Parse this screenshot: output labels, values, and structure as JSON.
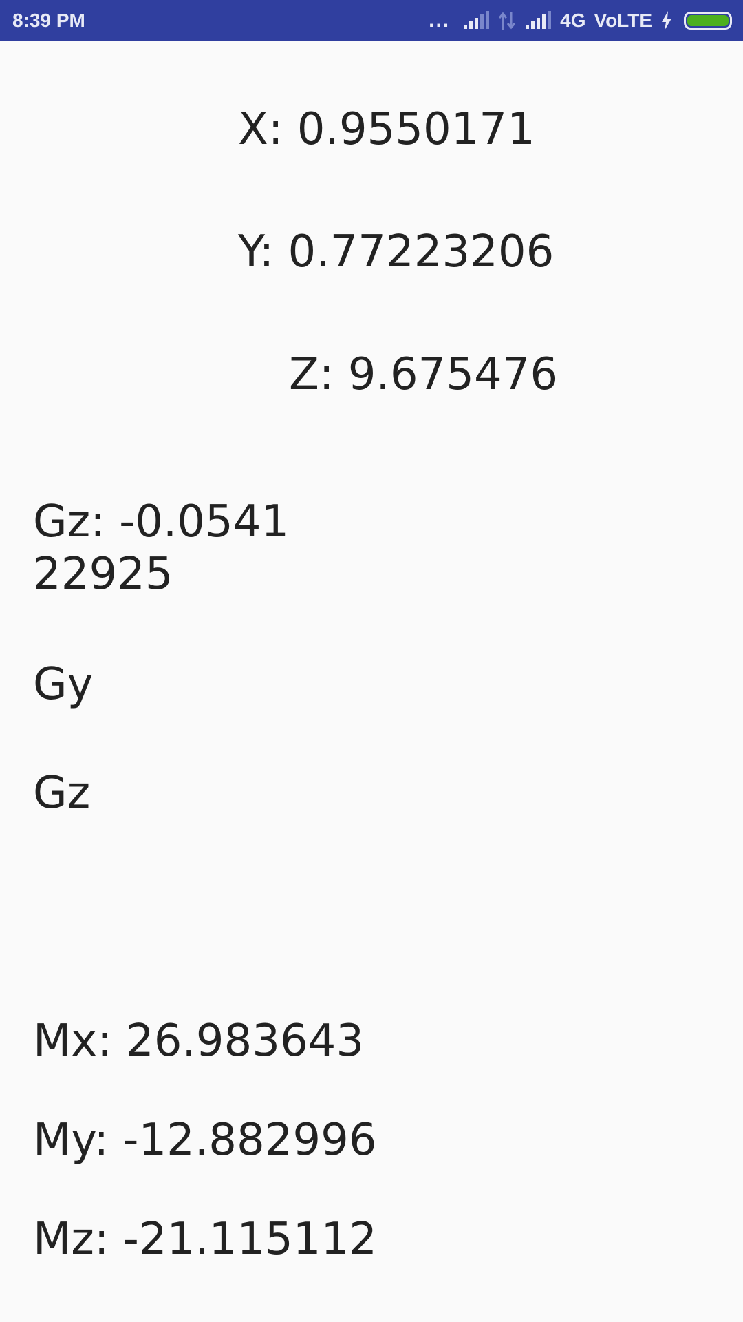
{
  "status_bar": {
    "time": "8:39 PM",
    "network": "4G",
    "volte": "VoLTE",
    "dots": "..."
  },
  "accelerometer": {
    "x": "X: 0.9550171",
    "y": "Y: 0.77223206",
    "z": "Z: 9.675476"
  },
  "gyroscope": {
    "gz_value": "Gz: -0.054122925",
    "gy_label": "Gy",
    "gz_label": "Gz"
  },
  "magnetometer": {
    "mx": "Mx: 26.983643",
    "my": "My: -12.882996",
    "mz": "Mz: -21.115112"
  }
}
